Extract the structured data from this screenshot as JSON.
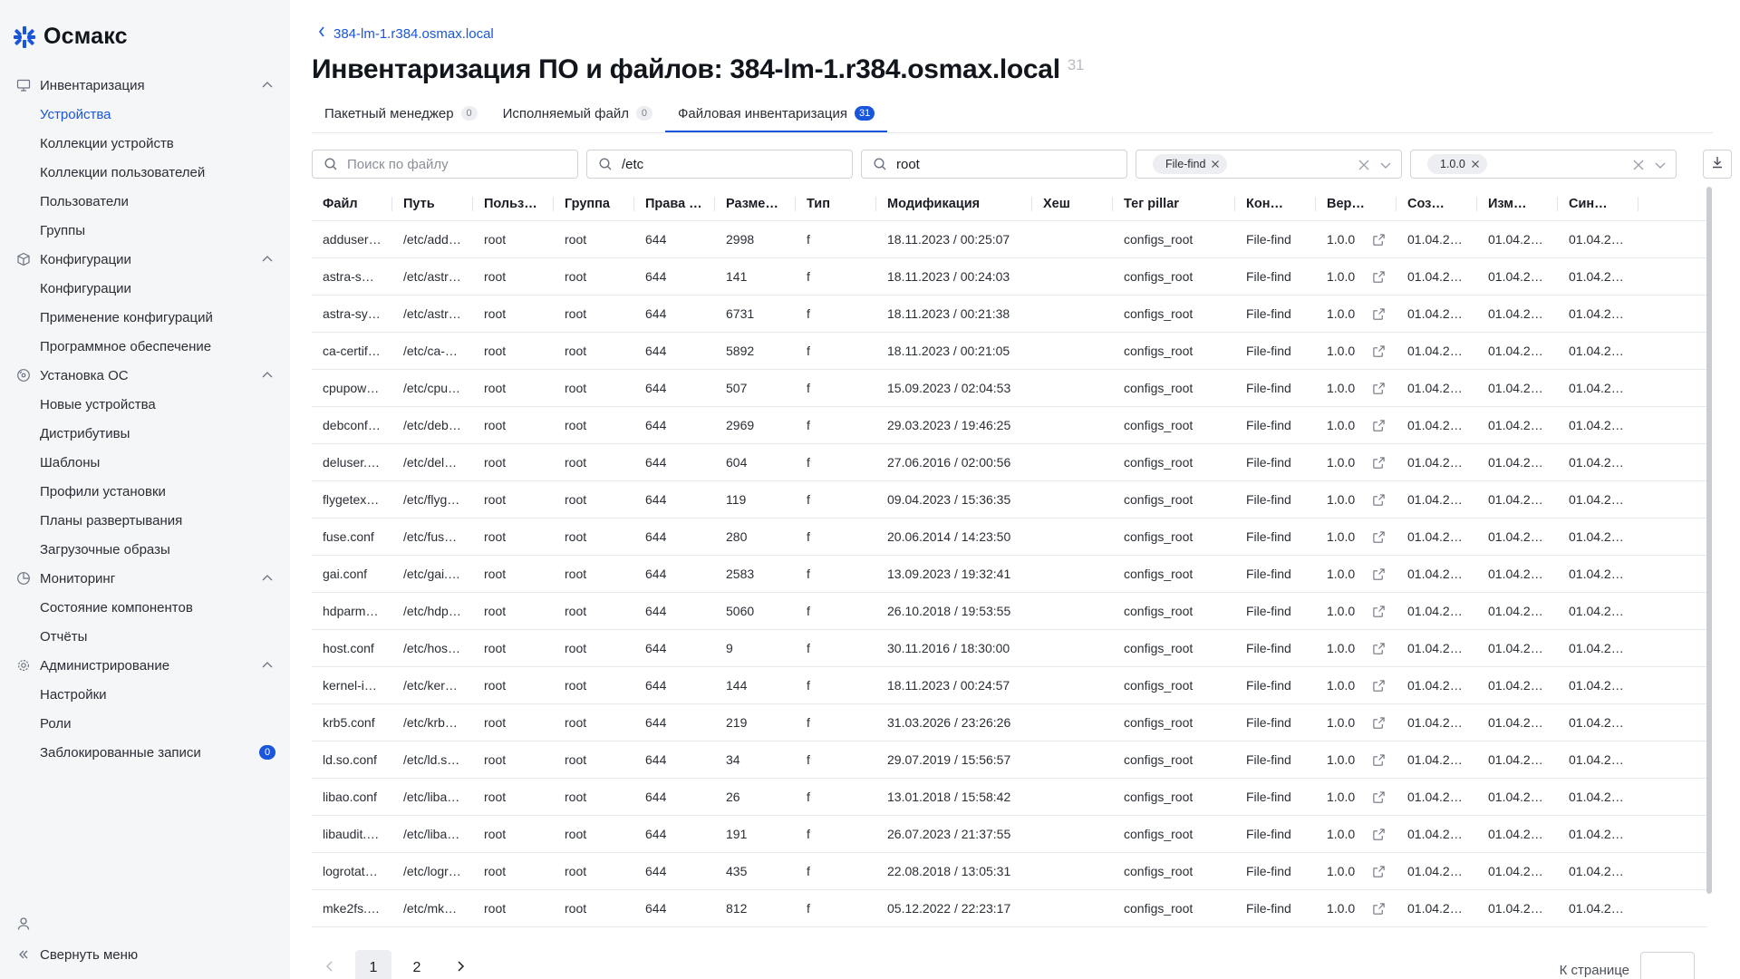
{
  "app": {
    "name": "Осмакс"
  },
  "sidebar": {
    "groups": [
      {
        "label": "Инвентаризация",
        "icon": "monitor-icon",
        "items": [
          {
            "label": "Устройства",
            "active": true
          },
          {
            "label": "Коллекции устройств"
          },
          {
            "label": "Коллекции пользователей"
          },
          {
            "label": "Пользователи"
          },
          {
            "label": "Группы"
          }
        ]
      },
      {
        "label": "Конфигурации",
        "icon": "cube-icon",
        "items": [
          {
            "label": "Конфигурации"
          },
          {
            "label": "Применение конфигураций"
          },
          {
            "label": "Программное обеспечение"
          }
        ]
      },
      {
        "label": "Установка ОС",
        "icon": "disc-icon",
        "items": [
          {
            "label": "Новые устройства"
          },
          {
            "label": "Дистрибутивы"
          },
          {
            "label": "Шаблоны"
          },
          {
            "label": "Профили установки"
          },
          {
            "label": "Планы развертывания"
          },
          {
            "label": "Загрузочные образы"
          }
        ]
      },
      {
        "label": "Мониторинг",
        "icon": "pie-chart-icon",
        "items": [
          {
            "label": "Состояние компонентов"
          },
          {
            "label": "Отчёты"
          }
        ]
      },
      {
        "label": "Администрирование",
        "icon": "gear-icon",
        "items": [
          {
            "label": "Настройки"
          },
          {
            "label": "Роли"
          },
          {
            "label": "Заблокированные записи",
            "badge": "0"
          }
        ]
      }
    ],
    "collapse_label": "Свернуть меню"
  },
  "breadcrumb": {
    "label": "384-lm-1.r384.osmax.local"
  },
  "page": {
    "title": "Инвентаризация ПО и файлов: 384-lm-1.r384.osmax.local",
    "count": "31"
  },
  "tabs": [
    {
      "label": "Пакетный менеджер",
      "count": "0"
    },
    {
      "label": "Исполняемый файл",
      "count": "0"
    },
    {
      "label": "Файловая инвентаризация",
      "count": "31",
      "active": true
    }
  ],
  "filters": {
    "file_placeholder": "Поиск по файлу",
    "file_value": "",
    "path_value": "/etc",
    "user_value": "root",
    "connector_chip": "File-find",
    "version_chip": "1.0.0"
  },
  "table": {
    "headers": [
      "Файл",
      "Путь",
      "Польз…",
      "Группа",
      "Права …",
      "Разме…",
      "Тип",
      "Модификация",
      "Хеш",
      "Тег pillar",
      "Кон…",
      "Вер…",
      "Соз…",
      "Изм…",
      "Син…"
    ],
    "rows": [
      [
        "adduser…",
        "/etc/add…",
        "root",
        "root",
        "644",
        "2998",
        "f",
        "18.11.2023 / 00:25:07",
        "",
        "configs_root",
        "File-find",
        "1.0.0",
        "01.04.2…",
        "01.04.2…",
        "01.04.2…"
      ],
      [
        "astra-s…",
        "/etc/astr…",
        "root",
        "root",
        "644",
        "141",
        "f",
        "18.11.2023 / 00:24:03",
        "",
        "configs_root",
        "File-find",
        "1.0.0",
        "01.04.2…",
        "01.04.2…",
        "01.04.2…"
      ],
      [
        "astra-sy…",
        "/etc/astr…",
        "root",
        "root",
        "644",
        "6731",
        "f",
        "18.11.2023 / 00:21:38",
        "",
        "configs_root",
        "File-find",
        "1.0.0",
        "01.04.2…",
        "01.04.2…",
        "01.04.2…"
      ],
      [
        "ca-certif…",
        "/etc/ca-…",
        "root",
        "root",
        "644",
        "5892",
        "f",
        "18.11.2023 / 00:21:05",
        "",
        "configs_root",
        "File-find",
        "1.0.0",
        "01.04.2…",
        "01.04.2…",
        "01.04.2…"
      ],
      [
        "cpupow…",
        "/etc/cpu…",
        "root",
        "root",
        "644",
        "507",
        "f",
        "15.09.2023 / 02:04:53",
        "",
        "configs_root",
        "File-find",
        "1.0.0",
        "01.04.2…",
        "01.04.2…",
        "01.04.2…"
      ],
      [
        "debconf…",
        "/etc/deb…",
        "root",
        "root",
        "644",
        "2969",
        "f",
        "29.03.2023 / 19:46:25",
        "",
        "configs_root",
        "File-find",
        "1.0.0",
        "01.04.2…",
        "01.04.2…",
        "01.04.2…"
      ],
      [
        "deluser.…",
        "/etc/del…",
        "root",
        "root",
        "644",
        "604",
        "f",
        "27.06.2016 / 02:00:56",
        "",
        "configs_root",
        "File-find",
        "1.0.0",
        "01.04.2…",
        "01.04.2…",
        "01.04.2…"
      ],
      [
        "flygetex…",
        "/etc/flyg…",
        "root",
        "root",
        "644",
        "119",
        "f",
        "09.04.2023 / 15:36:35",
        "",
        "configs_root",
        "File-find",
        "1.0.0",
        "01.04.2…",
        "01.04.2…",
        "01.04.2…"
      ],
      [
        "fuse.conf",
        "/etc/fus…",
        "root",
        "root",
        "644",
        "280",
        "f",
        "20.06.2014 / 14:23:50",
        "",
        "configs_root",
        "File-find",
        "1.0.0",
        "01.04.2…",
        "01.04.2…",
        "01.04.2…"
      ],
      [
        "gai.conf",
        "/etc/gai.…",
        "root",
        "root",
        "644",
        "2583",
        "f",
        "13.09.2023 / 19:32:41",
        "",
        "configs_root",
        "File-find",
        "1.0.0",
        "01.04.2…",
        "01.04.2…",
        "01.04.2…"
      ],
      [
        "hdparm…",
        "/etc/hdp…",
        "root",
        "root",
        "644",
        "5060",
        "f",
        "26.10.2018 / 19:53:55",
        "",
        "configs_root",
        "File-find",
        "1.0.0",
        "01.04.2…",
        "01.04.2…",
        "01.04.2…"
      ],
      [
        "host.conf",
        "/etc/hos…",
        "root",
        "root",
        "644",
        "9",
        "f",
        "30.11.2016 / 18:30:00",
        "",
        "configs_root",
        "File-find",
        "1.0.0",
        "01.04.2…",
        "01.04.2…",
        "01.04.2…"
      ],
      [
        "kernel-i…",
        "/etc/ker…",
        "root",
        "root",
        "644",
        "144",
        "f",
        "18.11.2023 / 00:24:57",
        "",
        "configs_root",
        "File-find",
        "1.0.0",
        "01.04.2…",
        "01.04.2…",
        "01.04.2…"
      ],
      [
        "krb5.conf",
        "/etc/krb…",
        "root",
        "root",
        "644",
        "219",
        "f",
        "31.03.2026 / 23:26:26",
        "",
        "configs_root",
        "File-find",
        "1.0.0",
        "01.04.2…",
        "01.04.2…",
        "01.04.2…"
      ],
      [
        "ld.so.conf",
        "/etc/ld.s…",
        "root",
        "root",
        "644",
        "34",
        "f",
        "29.07.2019 / 15:56:57",
        "",
        "configs_root",
        "File-find",
        "1.0.0",
        "01.04.2…",
        "01.04.2…",
        "01.04.2…"
      ],
      [
        "libao.conf",
        "/etc/liba…",
        "root",
        "root",
        "644",
        "26",
        "f",
        "13.01.2018 / 15:58:42",
        "",
        "configs_root",
        "File-find",
        "1.0.0",
        "01.04.2…",
        "01.04.2…",
        "01.04.2…"
      ],
      [
        "libaudit.…",
        "/etc/liba…",
        "root",
        "root",
        "644",
        "191",
        "f",
        "26.07.2023 / 21:37:55",
        "",
        "configs_root",
        "File-find",
        "1.0.0",
        "01.04.2…",
        "01.04.2…",
        "01.04.2…"
      ],
      [
        "logrotat…",
        "/etc/logr…",
        "root",
        "root",
        "644",
        "435",
        "f",
        "22.08.2018 / 13:05:31",
        "",
        "configs_root",
        "File-find",
        "1.0.0",
        "01.04.2…",
        "01.04.2…",
        "01.04.2…"
      ],
      [
        "mke2fs.…",
        "/etc/mk…",
        "root",
        "root",
        "644",
        "812",
        "f",
        "05.12.2022 / 22:23:17",
        "",
        "configs_root",
        "File-find",
        "1.0.0",
        "01.04.2…",
        "01.04.2…",
        "01.04.2…"
      ]
    ]
  },
  "pagination": {
    "pages": [
      "1",
      "2"
    ],
    "current": "1",
    "per_page_label": "К странице"
  },
  "colors": {
    "accent": "#1a56db",
    "sidebar_bg": "#f5f6f8",
    "border": "#cfd3d9"
  }
}
